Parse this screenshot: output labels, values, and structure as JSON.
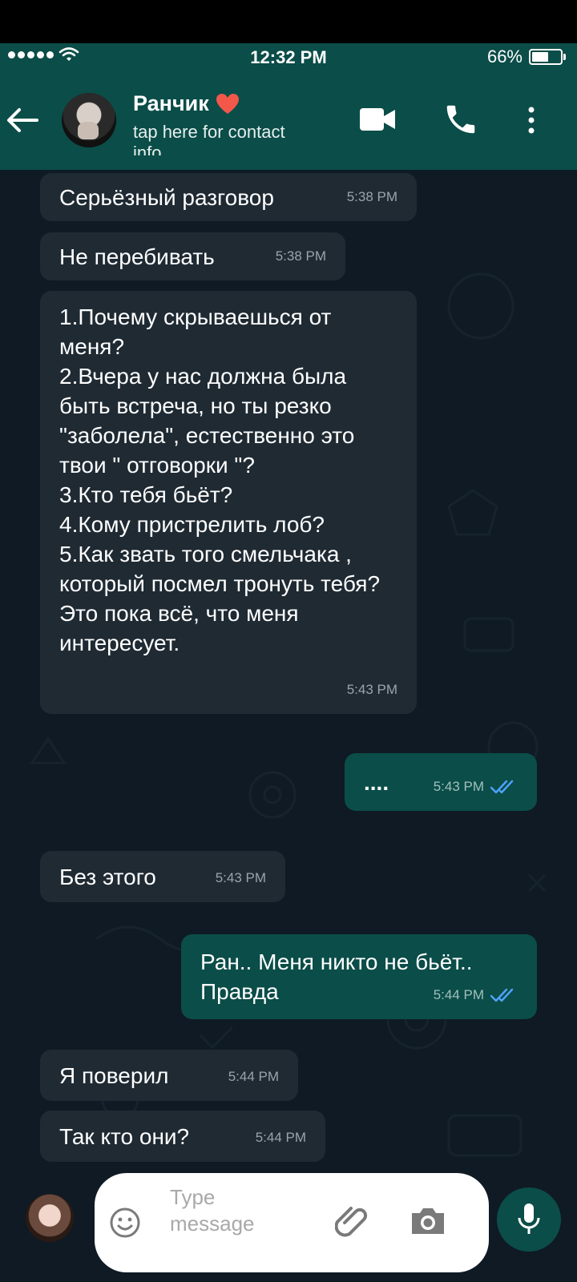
{
  "status_bar": {
    "time": "12:32 PM",
    "battery": "66%",
    "battery_level": 0.66,
    "icons": [
      "signal-dots-icon",
      "wifi-icon",
      "battery-icon"
    ]
  },
  "header": {
    "contact_name": "Ранчик",
    "name_emoji": "❤️",
    "subtitle": "tap here for contact info",
    "icons": [
      "back-arrow-icon",
      "video-call-icon",
      "phone-call-icon",
      "more-options-icon"
    ]
  },
  "messages": [
    {
      "direction": "in",
      "text": "Серьёзный разговор",
      "time": "5:38 PM"
    },
    {
      "direction": "in",
      "text": "Не перебивать",
      "time": "5:38 PM"
    },
    {
      "direction": "in",
      "text": "1.Почему скрываешься от меня?\n2.Вчера у нас должна была быть встреча, но ты резко \"заболела\", естественно это твои \" отговорки \"?\n3.Кто тебя бьёт?\n4.Кому пристрелить лоб?\n5.Как звать того смельчака , который посмел тронуть тебя?\nЭто пока всё, что меня интересует.",
      "time": "5:43 PM"
    },
    {
      "direction": "out",
      "text": "....",
      "time": "5:43 PM",
      "status": "read"
    },
    {
      "direction": "in",
      "text": "Без этого",
      "time": "5:43 PM"
    },
    {
      "direction": "out",
      "text": "Ран.. Меня никто не бьёт.. Правда",
      "time": "5:44 PM",
      "status": "read"
    },
    {
      "direction": "in",
      "text": "Я поверил",
      "time": "5:44 PM"
    },
    {
      "direction": "in",
      "text": "Так кто они?",
      "time": "5:44 PM"
    }
  ],
  "composer": {
    "placeholder": "Type message",
    "icons": [
      "emoji-icon",
      "attachment-icon",
      "camera-icon",
      "microphone-icon"
    ]
  },
  "colors": {
    "header_bg": "#0b4d48",
    "chat_bg": "#0f1a24",
    "incoming_bubble": "#1f2a33",
    "outgoing_bubble": "#0b4d48",
    "read_tick": "#4fa3ff"
  }
}
